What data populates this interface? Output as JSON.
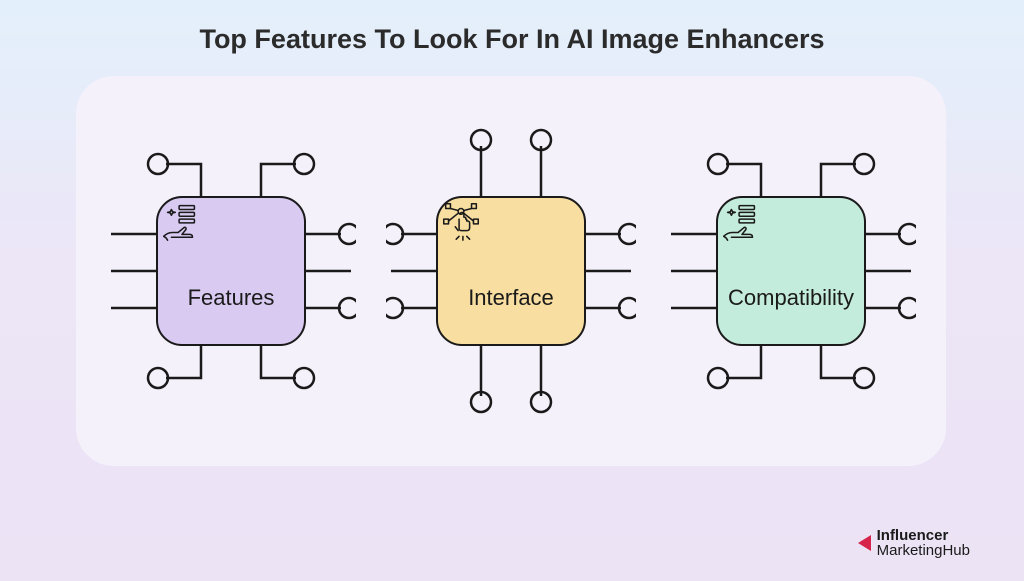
{
  "title": "Top Features To Look For In AI Image Enhancers",
  "cards": [
    {
      "label": "Features",
      "color": "purple",
      "icon": "hand-stars-icon"
    },
    {
      "label": "Interface",
      "color": "yellow",
      "icon": "touch-network-icon"
    },
    {
      "label": "Compatibility",
      "color": "green",
      "icon": "hand-stars-icon"
    }
  ],
  "brand": {
    "line1": "Influencer",
    "line2": "MarketingHub"
  }
}
